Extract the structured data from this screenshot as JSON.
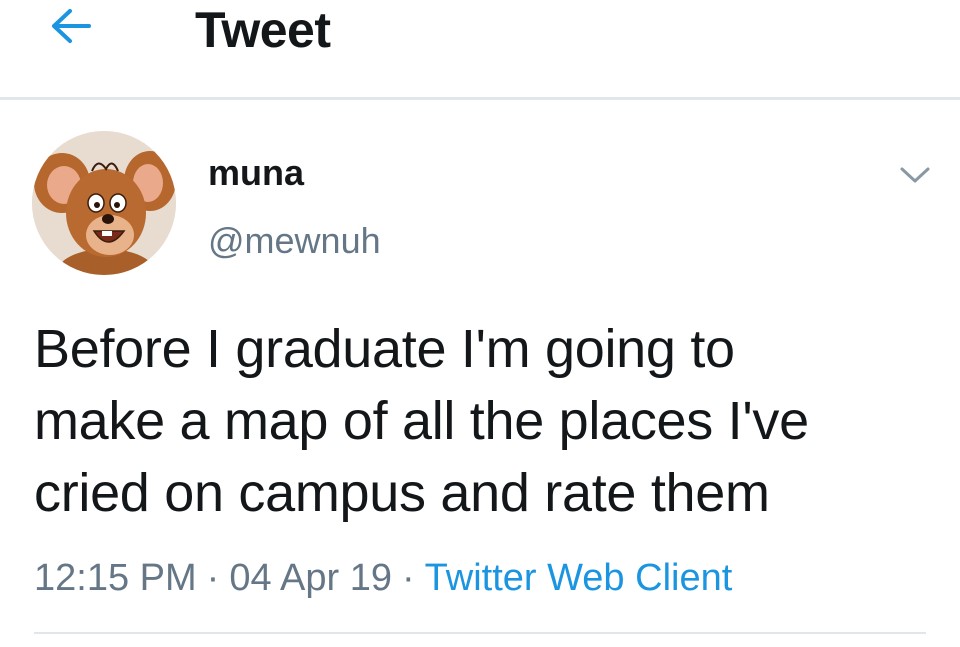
{
  "header": {
    "back_icon": "arrow-left-icon",
    "title": "Tweet"
  },
  "author": {
    "display_name": "muna",
    "handle": "@mewnuh",
    "avatar": "cartoon-mouse-avatar",
    "caret_icon": "chevron-down-icon"
  },
  "tweet": {
    "lines": [
      "Before I graduate I'm going to",
      "make a map of all the places I've",
      "cried on campus and rate them"
    ],
    "time": "12:15 PM",
    "separator": "·",
    "date": "04 Apr 19",
    "client": "Twitter Web Client"
  },
  "colors": {
    "accent": "#1b95e0",
    "secondary_text": "#657786",
    "primary_text": "#14171a",
    "border": "#e1e6ea"
  }
}
